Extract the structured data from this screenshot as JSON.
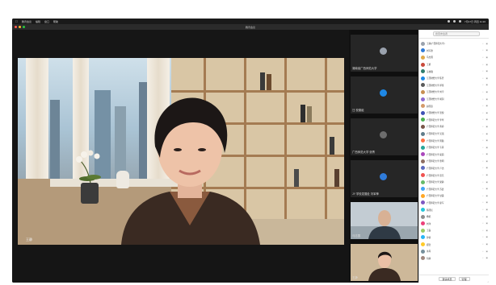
{
  "menubar": {
    "app_name": "腾讯会议",
    "items": [
      "编辑",
      "窗口",
      "帮助"
    ],
    "clock": "7月17日 周四 11:20"
  },
  "window": {
    "title": "腾讯会议"
  },
  "speaker": {
    "name": "王静"
  },
  "thumbnails": [
    {
      "label": "湖南省广西师范大学",
      "avatar_color": "#9aa2ad"
    },
    {
      "label": "汪 校徽组",
      "avatar_color": "#1e88e5"
    },
    {
      "label": "广西师范大学 张青",
      "avatar_color": "#6d6d6d"
    },
    {
      "label": "JY 学校发展处 刘军锋",
      "avatar_color": "#2f7bd9"
    },
    {
      "label": "马志国",
      "avatar_color": "#5b6f85"
    },
    {
      "label": "王静",
      "avatar_color": "#3a2a23"
    }
  ],
  "panel": {
    "search_placeholder": "搜索参会者",
    "participants": [
      {
        "name": "王静(广西师范大学)",
        "color": "#9aa2ad"
      },
      {
        "name": "刘军锋",
        "color": "#2f7bd9"
      },
      {
        "name": "马志国",
        "color": "#e0a94b"
      },
      {
        "name": "王勇",
        "color": "#c94a3b"
      },
      {
        "name": "汪校徽",
        "color": "#2e7d6e"
      },
      {
        "name": "江西财经大学 陈芳",
        "color": "#1e88e5"
      },
      {
        "name": "江西财经大学 邓佳",
        "color": "#5a5a5a"
      },
      {
        "name": "江西财经大学 刘宇",
        "color": "#c78f52"
      },
      {
        "name": "江西财经大学 胡润",
        "color": "#8e6ad1"
      },
      {
        "name": "赵晓燕",
        "color": "#d49a6a"
      },
      {
        "name": "广西财经大学 张悦",
        "color": "#3f51b5"
      },
      {
        "name": "广西师范大学 李华",
        "color": "#4caf50"
      },
      {
        "name": "广西师范大学 黄婷",
        "color": "#795548"
      },
      {
        "name": "广西师范大学 吴强",
        "color": "#607d8b"
      },
      {
        "name": "广西师范大学 周颖",
        "color": "#ff7043"
      },
      {
        "name": "广西师范大学 韦丹",
        "color": "#26a69a"
      },
      {
        "name": "广西师范大学 蒙丽",
        "color": "#ab47bc"
      },
      {
        "name": "广西师范大学 覃明",
        "color": "#8d6e63"
      },
      {
        "name": "广西师范大学 卢洁",
        "color": "#5c6bc0"
      },
      {
        "name": "广西师范大学 莫凡",
        "color": "#ef5350"
      },
      {
        "name": "广西师范大学 梁静",
        "color": "#66bb6a"
      },
      {
        "name": "广西师范大学 苏晨",
        "color": "#42a5f5"
      },
      {
        "name": "广西师范大学 甘露",
        "color": "#ffa726"
      },
      {
        "name": "广西师范大学 廖军",
        "color": "#7e57c2"
      },
      {
        "name": "陈晓红",
        "color": "#26c6da"
      },
      {
        "name": "杨帆",
        "color": "#8d8d8d"
      },
      {
        "name": "刘洋",
        "color": "#ec407a"
      },
      {
        "name": "王磊",
        "color": "#9ccc65"
      },
      {
        "name": "孙倩",
        "color": "#29b6f6"
      },
      {
        "name": "郑浩",
        "color": "#ffca28"
      },
      {
        "name": "许丹",
        "color": "#78909c"
      },
      {
        "name": "何静",
        "color": "#a1887f"
      }
    ],
    "footer": {
      "invite": "邀请成员",
      "manage": "管理"
    }
  }
}
